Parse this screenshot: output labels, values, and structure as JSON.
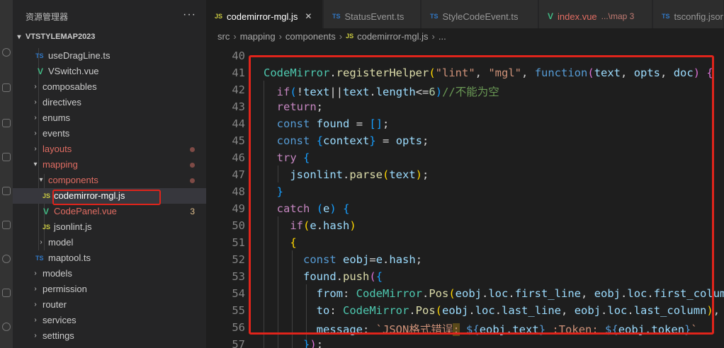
{
  "sidebar": {
    "title": "资源管理器",
    "more": "···",
    "root": "VTSTYLEMAP2023",
    "items": [
      {
        "label": "useDragLine.ts",
        "icon": "TS"
      },
      {
        "label": "VSwitch.vue",
        "icon": "V"
      },
      {
        "label": "composables"
      },
      {
        "label": "directives"
      },
      {
        "label": "enums"
      },
      {
        "label": "events"
      },
      {
        "label": "layouts"
      },
      {
        "label": "mapping"
      },
      {
        "label": "components"
      },
      {
        "label": "codemirror-mgl.js",
        "icon": "JS"
      },
      {
        "label": "CodePanel.vue",
        "icon": "V",
        "badge": "3"
      },
      {
        "label": "jsonlint.js",
        "icon": "JS"
      },
      {
        "label": "model"
      },
      {
        "label": "maptool.ts",
        "icon": "TS"
      },
      {
        "label": "models"
      },
      {
        "label": "permission"
      },
      {
        "label": "router"
      },
      {
        "label": "services"
      },
      {
        "label": "settings"
      }
    ]
  },
  "tabs": [
    {
      "label": "codemirror-mgl.js",
      "icon": "JS",
      "active": true
    },
    {
      "label": "StatusEvent.ts",
      "icon": "TS"
    },
    {
      "label": "StyleCodeEvent.ts",
      "icon": "TS"
    },
    {
      "label": "index.vue",
      "icon": "V",
      "hint": "...\\map 3"
    },
    {
      "label": "tsconfig.json",
      "icon": "TS"
    }
  ],
  "breadcrumb": [
    "src",
    "mapping",
    "components",
    "codemirror-mgl.js",
    "..."
  ],
  "breadcrumb_icon": "JS",
  "editor": {
    "line_numbers": [
      "40",
      "41",
      "42",
      "43",
      "44",
      "45",
      "46",
      "47",
      "48",
      "49",
      "50",
      "51",
      "52",
      "53",
      "54",
      "55",
      "56",
      "57"
    ],
    "lines": [
      "",
      "CodeMirror.registerHelper(\"lint\", \"mgl\", function(text, opts, doc) {",
      "  if(!text||text.length<=6)//不能为空",
      "  return;",
      "  const found = [];",
      "  const {context} = opts;",
      "  try {",
      "    jsonlint.parse(text);",
      "  }",
      "  catch (e) {",
      "    if(e.hash)",
      "    {",
      "      const eobj=e.hash;",
      "      found.push({",
      "        from: CodeMirror.Pos(eobj.loc.first_line, eobj.loc.first_column),",
      "        to: CodeMirror.Pos(eobj.loc.last_line, eobj.loc.last_column),",
      "        message: `JSON格式错误: ${eobj.text} ;Token: ${eobj.token}`",
      "      });"
    ]
  },
  "colors": {
    "annotation_red": "#e0241b",
    "keyword": "#c586c0",
    "string": "#ce9178",
    "function": "#dcdcaa"
  }
}
